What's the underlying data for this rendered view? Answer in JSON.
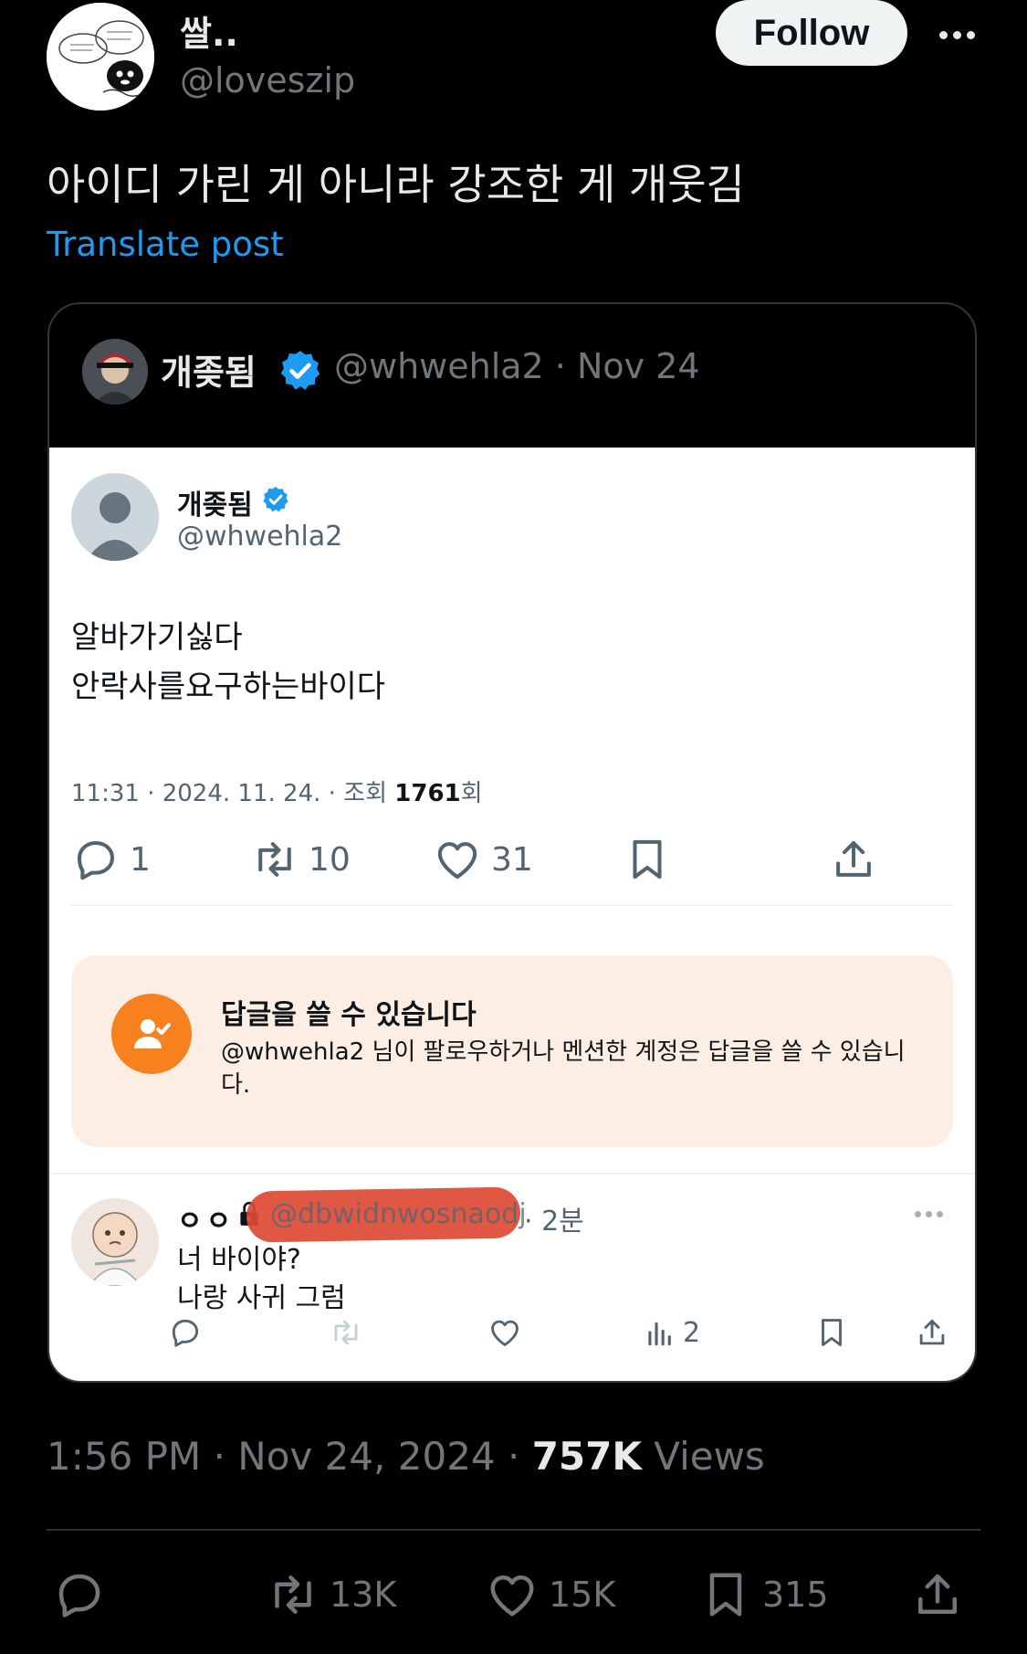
{
  "author": {
    "display_name": "쌀..",
    "handle": "@loveszip",
    "follow_label": "Follow"
  },
  "post": {
    "text": "아이디 가린 게 아니라 강조한 게 개웃김",
    "translate_label": "Translate post",
    "timestamp": "1:56 PM · Nov 24, 2024 · ",
    "views_count": "757K",
    "views_label": " Views"
  },
  "quote": {
    "display_name": "개좆됨",
    "meta": "@whwehla2 · Nov 24",
    "inner": {
      "display_name": "개좆됨",
      "handle": "@whwehla2",
      "body_line1": "알바가기싫다",
      "body_line2": "안락사를요구하는바이다",
      "timestamp_prefix": "11:31 · 2024. 11. 24. · 조회 ",
      "view_count": "1761",
      "timestamp_suffix": "회",
      "actions": {
        "reply_count": "1",
        "retweet_count": "10",
        "like_count": "31"
      },
      "reply_notice": {
        "title": "답글을 쓸 수 있습니다",
        "description": "@whwehla2 님이 팔로우하거나 멘션한 계정은 답글을 쓸 수 있습니다."
      },
      "reply": {
        "name": "ㅇㅇ",
        "handle": "@dbwidnwosnaodj",
        "time": "· 2분",
        "line1": "너 바이야?",
        "line2": "나랑 사귀 그럼",
        "views_count": "2"
      }
    }
  },
  "stats": {
    "retweets": "13K",
    "likes": "15K",
    "bookmarks": "315"
  },
  "colors": {
    "accent": "#1d9bf0",
    "background": "#000000",
    "reply_notice_bg": "#fdeee3",
    "reply_notice_icon": "#f7811f",
    "redaction": "#dd4a33"
  }
}
